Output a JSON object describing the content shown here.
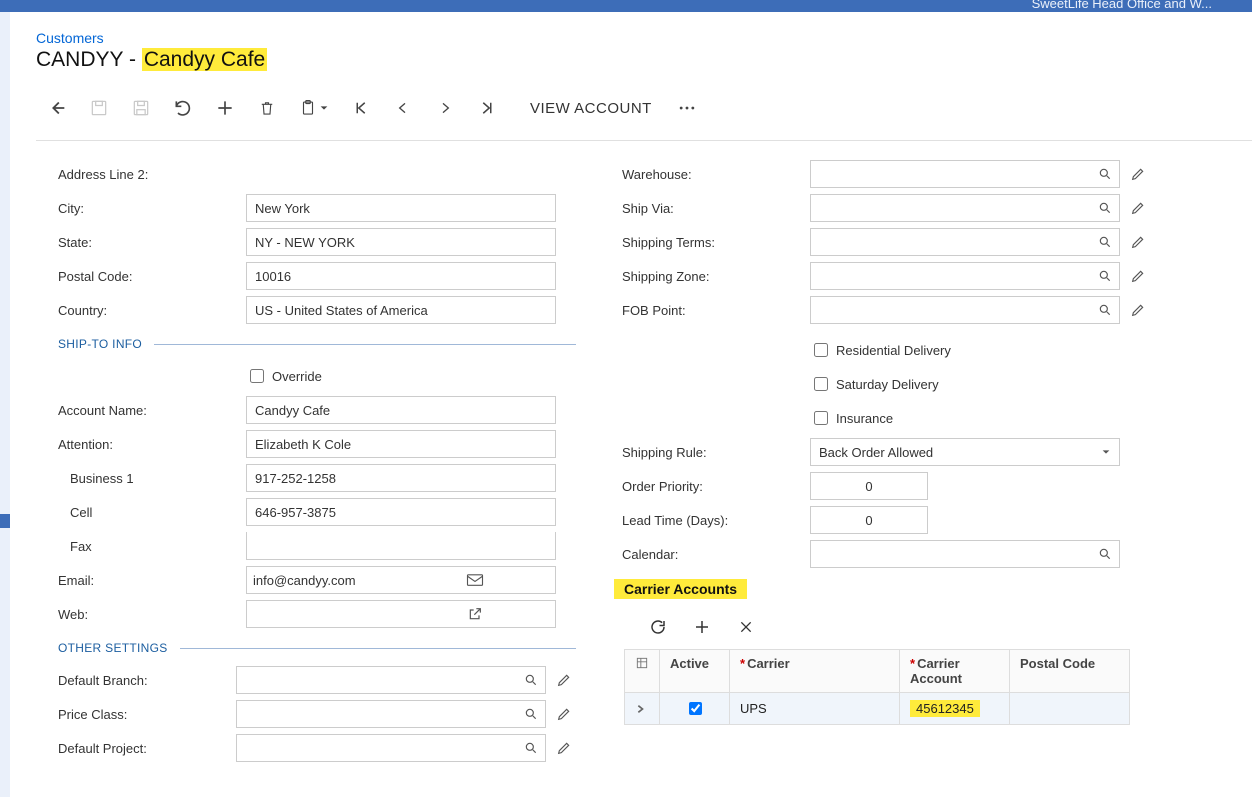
{
  "top_right_text": "SweetLife Head Office and W...",
  "breadcrumb": "Customers",
  "title_prefix": "CANDYY - ",
  "title_highlight": "Candyy Cafe",
  "toolbar": {
    "view_account": "VIEW ACCOUNT"
  },
  "left": {
    "addr2_label": "Address Line 2:",
    "addr2_value": "",
    "city_label": "City:",
    "city_value": "New York",
    "state_label": "State:",
    "state_value": "NY - NEW YORK",
    "postal_label": "Postal Code:",
    "postal_value": "10016",
    "country_label": "Country:",
    "country_value": "US - United States of America",
    "section_shipto": "SHIP-TO INFO",
    "override_label": "Override",
    "account_name_label": "Account Name:",
    "account_name_value": "Candyy Cafe",
    "attention_label": "Attention:",
    "attention_value": "Elizabeth K Cole",
    "bus1_label": "Business 1",
    "bus1_value": "917-252-1258",
    "cell_label": "Cell",
    "cell_value": "646-957-3875",
    "fax_label": "Fax",
    "fax_value": "",
    "email_label": "Email:",
    "email_value": "info@candyy.com",
    "web_label": "Web:",
    "web_value": "",
    "section_other": "OTHER SETTINGS",
    "default_branch_label": "Default Branch:",
    "price_class_label": "Price Class:",
    "default_project_label": "Default Project:"
  },
  "right": {
    "warehouse_label": "Warehouse:",
    "shipvia_label": "Ship Via:",
    "shipterms_label": "Shipping Terms:",
    "shipzone_label": "Shipping Zone:",
    "fob_label": "FOB Point:",
    "residential_label": "Residential Delivery",
    "saturday_label": "Saturday Delivery",
    "insurance_label": "Insurance",
    "shiprule_label": "Shipping Rule:",
    "shiprule_value": "Back Order Allowed",
    "orderpriority_label": "Order Priority:",
    "orderpriority_value": "0",
    "leadtime_label": "Lead Time (Days):",
    "leadtime_value": "0",
    "calendar_label": "Calendar:",
    "carrier_section": "Carrier Accounts",
    "grid": {
      "col_active": "Active",
      "col_carrier": "Carrier",
      "col_account": "Carrier Account",
      "col_postal": "Postal Code",
      "rows": [
        {
          "active": true,
          "carrier": "UPS",
          "account": "45612345",
          "postal": ""
        }
      ]
    }
  }
}
